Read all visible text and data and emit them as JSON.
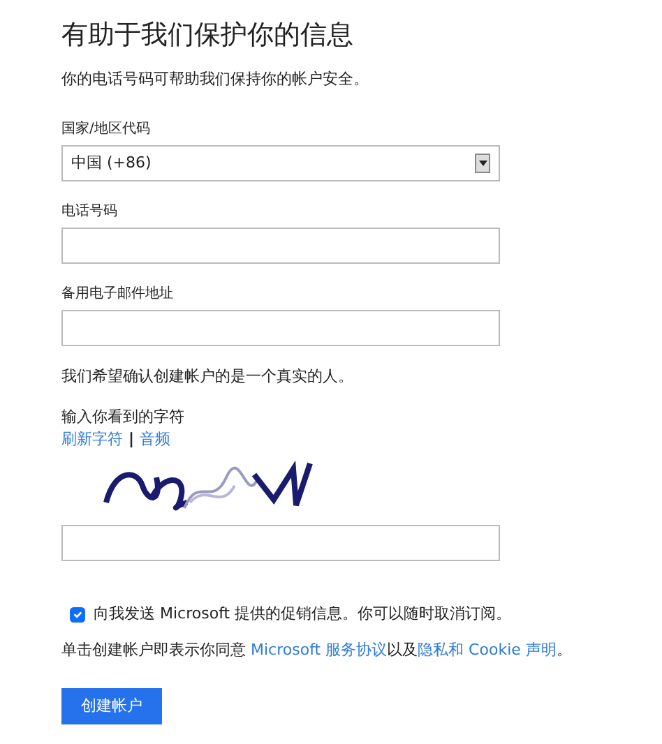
{
  "title": "有助于我们保护你的信息",
  "subtitle": "你的电话号码可帮助我们保持你的帐户安全。",
  "fields": [
    {
      "kind": "select",
      "label": "国家/地区代码",
      "value": "中国 (+86)"
    },
    {
      "kind": "text",
      "label": "电话号码"
    },
    {
      "kind": "text",
      "label": "备用电子邮件地址"
    }
  ],
  "verify_note": "我们希望确认创建帐户的是一个真实的人。",
  "captcha": {
    "label": "输入你看到的字符",
    "links": [
      "刷新字符",
      "音频"
    ],
    "separator": "|",
    "image": {
      "kind": "picture"
    }
  },
  "promo": {
    "checked": true,
    "label": "向我发送 Microsoft 提供的促销信息。你可以随时取消订阅。"
  },
  "terms": [
    {
      "kind": "text",
      "text": "单击创建帐户即表示你同意 "
    },
    {
      "kind": "link",
      "text": "Microsoft 服务协议"
    },
    {
      "kind": "text",
      "text": "以及"
    },
    {
      "kind": "link",
      "text": "隐私和 Cookie 声明"
    },
    {
      "kind": "text",
      "text": "。"
    }
  ],
  "submit": "创建帐户"
}
